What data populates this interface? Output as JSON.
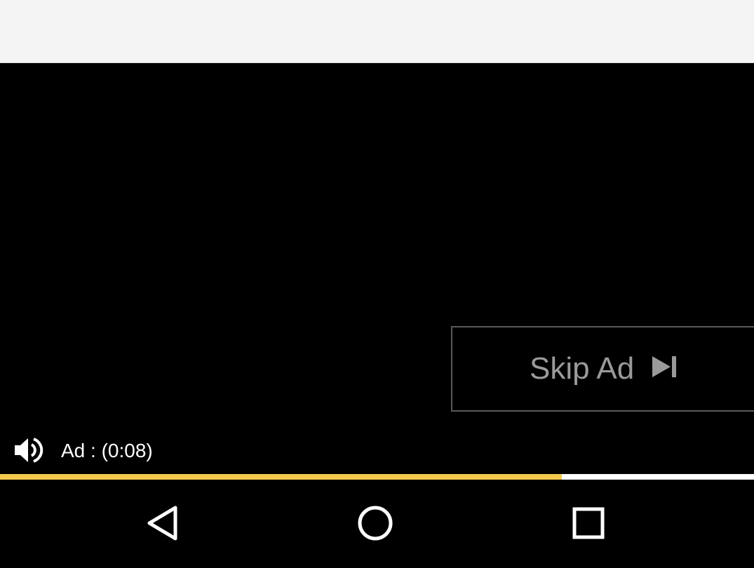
{
  "skip_ad": {
    "label": "Skip Ad",
    "icon": "skip-next-icon"
  },
  "ad": {
    "countdown": "Ad : (0:08)",
    "progress_fraction": 0.745
  },
  "controls": {
    "volume_icon": "volume-on-icon"
  },
  "colors": {
    "progress_played": "#f2c94c",
    "progress_remaining": "#ffffff",
    "top_bar": "#f4f4f4"
  },
  "nav_bar": {
    "icons": [
      "back-icon",
      "home-icon",
      "recents-icon"
    ]
  }
}
